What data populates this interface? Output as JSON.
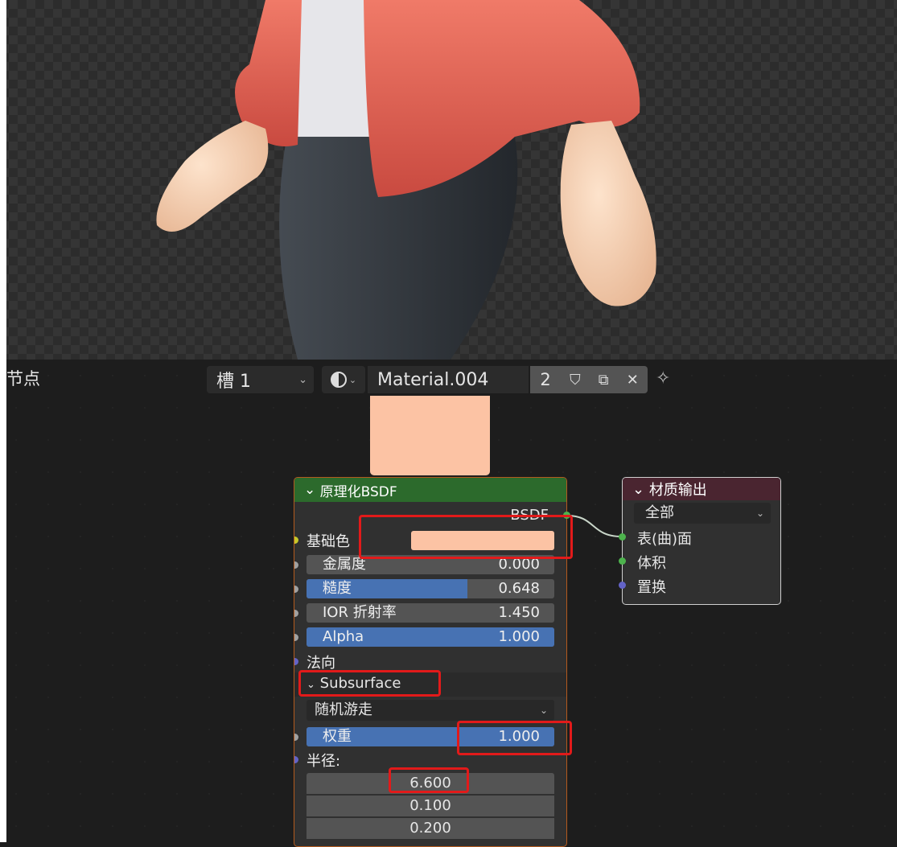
{
  "header": {
    "editor_title": "节点",
    "slot": "槽 1",
    "material_name": "Material.004",
    "user_count": "2",
    "buttons": [
      "fake-user-icon",
      "duplicate-icon",
      "unlink-icon"
    ]
  },
  "bsdf_node": {
    "title": "原理化BSDF",
    "output_label": "BSDF",
    "base_color_label": "基础色",
    "base_color_value": "#fcc3a4",
    "fields": [
      {
        "label": "金属度",
        "value": "0.000",
        "fill": 0
      },
      {
        "label": "糙度",
        "value": "0.648",
        "fill": 0.648
      },
      {
        "label": "IOR 折射率",
        "value": "1.450",
        "fill": 0
      },
      {
        "label": "Alpha",
        "value": "1.000",
        "fill": 1
      }
    ],
    "normal_label": "法向",
    "subsurface_label": "Subsurface",
    "subsurface_method": "随机游走",
    "weight": {
      "label": "权重",
      "value": "1.000",
      "fill": 1
    },
    "radius_label": "半径:",
    "radius": [
      "6.600",
      "0.100",
      "0.200"
    ]
  },
  "output_node": {
    "title": "材质输出",
    "target": "全部",
    "inputs": [
      "表(曲)面",
      "体积",
      "置换"
    ]
  },
  "colors": {
    "accent": "#4772b3",
    "node_header": "#2c6a2c",
    "output_header": "#4a2530",
    "highlight": "#e21a1a"
  }
}
